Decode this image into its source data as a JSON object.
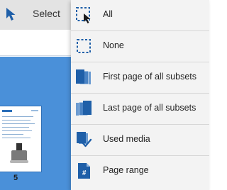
{
  "toolbar": {
    "select_label": "Select"
  },
  "menu": {
    "items": [
      {
        "label": "All",
        "icon": "select-all-icon"
      },
      {
        "label": "None",
        "icon": "select-none-icon"
      },
      {
        "label": "First page of all subsets",
        "icon": "first-page-subsets-icon"
      },
      {
        "label": "Last page of all subsets",
        "icon": "last-page-subsets-icon"
      },
      {
        "label": "Used media",
        "icon": "used-media-icon"
      },
      {
        "label": "Page range",
        "icon": "page-range-icon"
      }
    ]
  },
  "thumbnails": [
    {
      "page_number": "5"
    }
  ],
  "colors": {
    "accent": "#1f5fa8",
    "workspace": "#4a90d9",
    "menu_bg": "#f3f3f3"
  }
}
